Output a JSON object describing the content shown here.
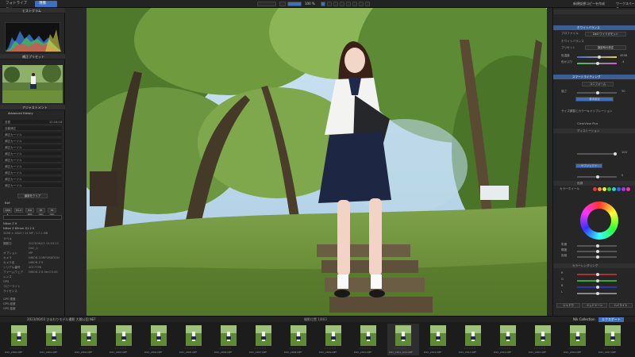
{
  "topbar": {
    "library_tab": "フォトライブラリ",
    "develop_tab": "現像",
    "zoom": "100 %",
    "right_label_1": "新規仮想コピーを作成",
    "right_label_2": "ワークスペース"
  },
  "left_panel": {
    "histogram_title": "ヒストグラム",
    "history_title": "補正プリセット",
    "navigator_title": "撮影データ",
    "adjust_title": "アジャストメント",
    "advanced_history_title": "Advanced History",
    "history_items": [
      {
        "label": "変更",
        "value": "12:18:18"
      },
      {
        "label": "自動補正",
        "value": ""
      },
      {
        "label": "補正カーソル",
        "value": ""
      },
      {
        "label": "補正カーソル",
        "value": ""
      },
      {
        "label": "補正カーソル",
        "value": ""
      },
      {
        "label": "補正カーソル",
        "value": ""
      },
      {
        "label": "補正カーソル",
        "value": ""
      },
      {
        "label": "補正カーソル",
        "value": ""
      },
      {
        "label": "補正カーソル",
        "value": ""
      },
      {
        "label": "補正カーソル",
        "value": ""
      },
      {
        "label": "補正カーソル",
        "value": ""
      }
    ],
    "history_footer": "最新をクリア",
    "exif_title": "Exif",
    "exif_buttons": [
      "1/60 s",
      "f/1.2",
      "ISO 100",
      "85 mm",
      "35 mm"
    ],
    "lens_line_1": "Nikon Z 6",
    "lens_line_2": "Nikon Z 85mm f/1.2 S",
    "file_line": "3456 × 4000 / 24 MP / 17.1 MB",
    "meta": [
      {
        "k": "ラベル",
        "v": ""
      },
      {
        "k": "撮影日",
        "v": "2023/06/03 15:03:22"
      },
      {
        "k": "",
        "v": "DSC_0"
      },
      {
        "k": "オプション",
        "v": "MP"
      },
      {
        "k": "カメラ",
        "v": "NIKON CORPORATION"
      },
      {
        "k": "カメラ名",
        "v": "NIKON Z 6"
      },
      {
        "k": "シリアル番号",
        "v": "4017738"
      },
      {
        "k": "ファームウェア",
        "v": "NIKON Z 6 Ver.03.00"
      },
      {
        "k": "レンズ",
        "v": ""
      },
      {
        "k": "GPS",
        "v": ""
      },
      {
        "k": "コピーライト",
        "v": ""
      },
      {
        "k": "ライセンス",
        "v": ""
      },
      {
        "k": "GPS 緯度",
        "v": ""
      },
      {
        "k": "GPS 経度",
        "v": ""
      },
      {
        "k": "GPS 高度",
        "v": ""
      }
    ]
  },
  "right_panel": {
    "title": "ホワイトバランス",
    "profile": "プロファイル",
    "auto_label": "DxO ワイドガモット",
    "wb_label": "ホワイトバランス",
    "preset_label": "プリセット",
    "preset_value": "撮影時の設定",
    "temp_label": "色温度",
    "tint_label": "色かぶり",
    "temp_value": "4958",
    "tint_value": "-4",
    "section2": "スマートライティング",
    "section2_mode": "ユニフォーム",
    "section2_strength": "強さ",
    "section2_value": "50",
    "button_a": "基本設定",
    "button_b": "サブジェクト",
    "section3": "サイズ調整とカラーキャリブレーション",
    "clearview": "ClearView Plus",
    "section4": "ディストーション",
    "section5": "色調",
    "hsl_label": "カラーホイール",
    "tone_value_1": "100",
    "tone_value_2": "0",
    "color_section": "カラーレンダリング",
    "color_buttons": [
      "シャドウ",
      "ミッドトーン",
      "ハイライト"
    ],
    "saturation_labels": [
      "彩度",
      "輝度",
      "色相"
    ],
    "channel_labels": [
      "R",
      "G",
      "B",
      "L"
    ],
    "colors": {
      "accent": "#3e6fbf",
      "panel": "#262626"
    }
  },
  "filmstrip": {
    "path": "2023/06/03 ひまわりモデル撮影 大間公園 NEF",
    "count": "撮影位置   1/803",
    "btn1": "Nik Collection",
    "btn2": "エクスポート",
    "thumbs": [
      "DSC_2800.NEF",
      "DSC_2801.NEF",
      "DSC_2802.NEF",
      "DSC_2803.NEF",
      "DSC_2804.NEF",
      "DSC_2805.NEF",
      "DSC_2806.NEF",
      "DSC_2807.NEF",
      "DSC_2808.NEF",
      "DSC_2809.NEF",
      "DSC_2810.NEF",
      "DSC_2811_DxO.NEF",
      "DSC_2812.NEF",
      "DSC_2813.NEF",
      "DSC_2814.NEF",
      "DSC_2815.NEF",
      "DSC_2816.NEF",
      "DSC_2817.NEF"
    ]
  }
}
